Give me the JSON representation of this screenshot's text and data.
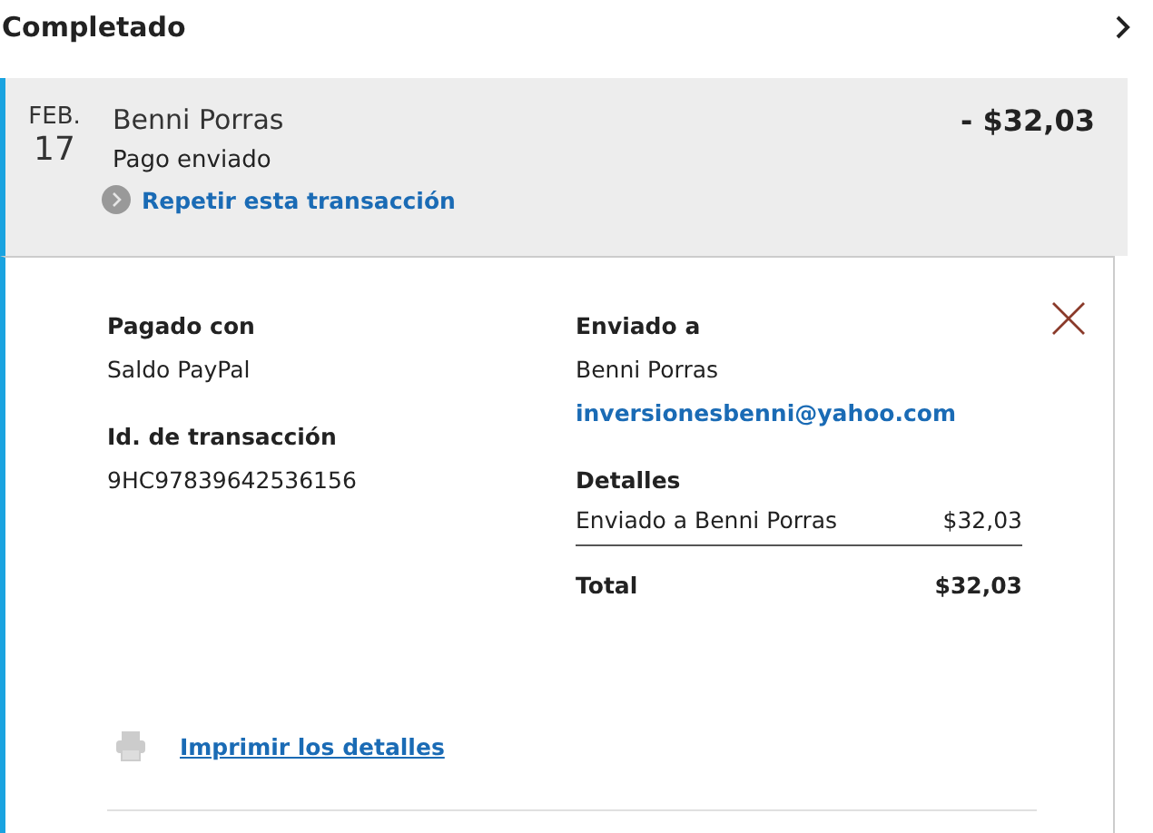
{
  "section_title": "Completado",
  "transaction": {
    "month": "FEB.",
    "day": "17",
    "name": "Benni Porras",
    "status": "Pago enviado",
    "amount": "- $32,03",
    "repeat_link": "Repetir esta transacción"
  },
  "details": {
    "paid_with_label": "Pagado con",
    "paid_with": "Saldo PayPal",
    "transaction_id_label": "Id. de transacción",
    "transaction_id": "9HC97839642536156",
    "sent_to_label": "Enviado a",
    "recipient_name": "Benni Porras",
    "recipient_email": "inversionesbenni@yahoo.com",
    "details_label": "Detalles",
    "line_items": [
      {
        "description": "Enviado a Benni Porras",
        "amount": "$32,03"
      }
    ],
    "total_label": "Total",
    "total": "$32,03",
    "print_link": "Imprimir los detalles"
  }
}
